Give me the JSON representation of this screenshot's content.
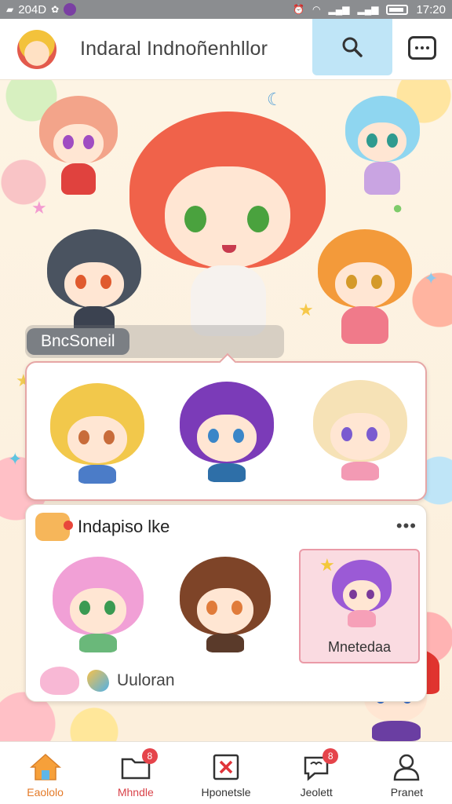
{
  "status_bar": {
    "left_text": "204D",
    "time": "17:20"
  },
  "header": {
    "title": "Indaral Indnoñenhllor",
    "search_icon": "search-icon",
    "more_icon": "more-horizontal-icon"
  },
  "scene": {
    "featured_label": "BncSoneil"
  },
  "character_grid": {
    "characters": [
      {
        "hair": "#f2c84b",
        "eyes": "#c86c3a"
      },
      {
        "hair": "#7b3bb8",
        "eyes": "#3a86c8"
      },
      {
        "hair": "#f6e2b6",
        "eyes": "#7a5bd0"
      }
    ]
  },
  "collection_card": {
    "title": "Indapiso lke",
    "more_label": "•••",
    "characters": [
      {
        "hair": "#f1a0d6",
        "eyes": "#3a9a52"
      },
      {
        "hair": "#7e4428",
        "eyes": "#e07b3a"
      }
    ],
    "selected_caption": "Mnetedaa",
    "footer_text": "Uuloran"
  },
  "bottom_nav": {
    "items": [
      {
        "label": "Eaololo",
        "icon": "home-icon",
        "badge": "",
        "state": "active"
      },
      {
        "label": "Mhndle",
        "icon": "folder-icon",
        "badge": "8",
        "state": "alt"
      },
      {
        "label": "Hponetsle",
        "icon": "close-box-icon",
        "badge": "",
        "state": ""
      },
      {
        "label": "Jeolett",
        "icon": "chat-icon",
        "badge": "8",
        "state": ""
      },
      {
        "label": "Pranet",
        "icon": "profile-icon",
        "badge": "",
        "state": ""
      }
    ]
  },
  "colors": {
    "accent": "#e47a28",
    "badge": "#e5444b",
    "search_bg": "#bfe5f7",
    "card_border": "#e6a6a6"
  }
}
